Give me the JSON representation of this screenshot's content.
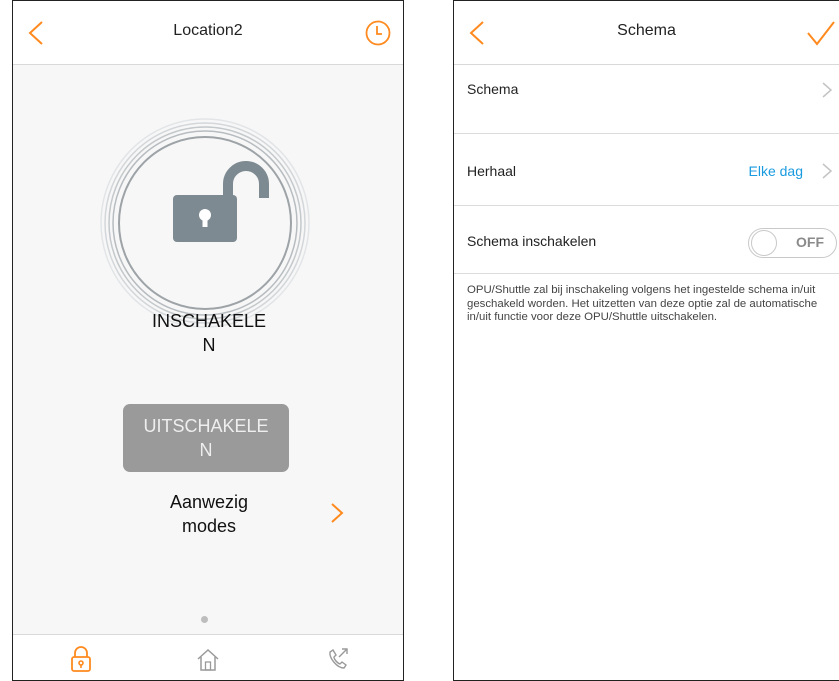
{
  "colors": {
    "accent": "#ff8a1f",
    "link": "#1a9be0",
    "lock_gray": "#7e8a91"
  },
  "left_screen": {
    "title": "Location2",
    "icons": {
      "back": "chevron-left-icon",
      "history": "clock-icon",
      "lock": "unlocked-padlock-icon"
    },
    "arm_label_line1": "INSCHAKELE",
    "arm_label_line2": "N",
    "disarm_button_line1": "UITSCHAKELE",
    "disarm_button_line2": "N",
    "modes_line1": "Aanwezig",
    "modes_line2": "modes",
    "page_indicator": {
      "count": 1,
      "active": 0
    },
    "bottom_tabs": [
      {
        "icon": "padlock-icon",
        "active": true
      },
      {
        "icon": "home-icon",
        "active": false
      },
      {
        "icon": "phone-call-icon",
        "active": false
      }
    ]
  },
  "right_screen": {
    "title": "Schema",
    "icons": {
      "back": "chevron-left-icon",
      "confirm": "checkmark-icon"
    },
    "rows": [
      {
        "label": "Schema",
        "value": ""
      },
      {
        "label": "Herhaal",
        "value": "Elke dag"
      }
    ],
    "toggle_row": {
      "label": "Schema inschakelen",
      "state_text": "OFF",
      "enabled": false
    },
    "description": "OPU/Shuttle zal bij inschakeling volgens het ingestelde schema in/uit geschakeld worden. Het uitzetten van deze optie zal de automatische in/uit functie voor deze OPU/Shuttle uitschakelen."
  }
}
